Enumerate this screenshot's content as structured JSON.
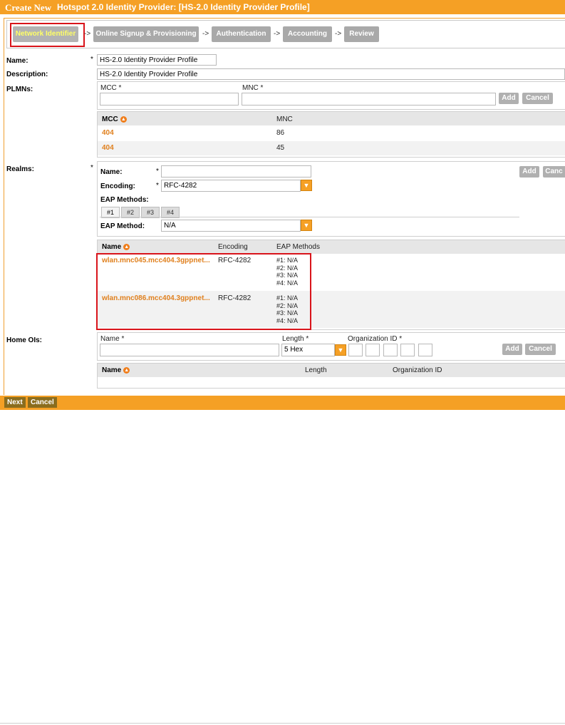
{
  "title": {
    "prefix": "Create New",
    "text": "Hotspot 2.0 Identity Provider: [HS-2.0 Identity Provider Profile]"
  },
  "wizard": {
    "steps": [
      "Network Identifier",
      "Online Signup & Provisioning",
      "Authentication",
      "Accounting",
      "Review"
    ],
    "arrow": "->"
  },
  "form": {
    "name_label": "Name:",
    "name_value": "HS-2.0 Identity Provider Profile",
    "description_label": "Description:",
    "description_value": "HS-2.0 Identity Provider Profile",
    "required_mark": "*"
  },
  "plmns": {
    "label": "PLMNs:",
    "mcc_label": "MCC *",
    "mnc_label": "MNC *",
    "add": "Add",
    "cancel": "Cancel",
    "columns": [
      "MCC",
      "MNC"
    ],
    "rows": [
      [
        "404",
        "86"
      ],
      [
        "404",
        "45"
      ]
    ]
  },
  "realms": {
    "label": "Realms:",
    "name_label": "Name:",
    "encoding_label": "Encoding:",
    "encoding_value": "RFC-4282",
    "eap_methods_label": "EAP Methods:",
    "tabs": [
      "#1",
      "#2",
      "#3",
      "#4"
    ],
    "eap_method_label": "EAP Method:",
    "eap_method_value": "N/A",
    "add": "Add",
    "cancel": "Canc",
    "columns": [
      "Name",
      "Encoding",
      "EAP Methods"
    ],
    "rows": [
      {
        "name": "wlan.mnc045.mcc404.3gppnet...",
        "encoding": "RFC-4282",
        "eap": [
          "#1: N/A",
          "#2: N/A",
          "#3: N/A",
          "#4: N/A"
        ]
      },
      {
        "name": "wlan.mnc086.mcc404.3gppnet...",
        "encoding": "RFC-4282",
        "eap": [
          "#1: N/A",
          "#2: N/A",
          "#3: N/A",
          "#4: N/A"
        ]
      }
    ]
  },
  "home_ois": {
    "label": "Home OIs:",
    "name_label": "Name *",
    "length_label": "Length *",
    "length_value": "5 Hex",
    "org_id_label": "Organization ID *",
    "add": "Add",
    "cancel": "Cancel",
    "columns": [
      "Name",
      "Length",
      "Organization ID"
    ]
  },
  "footer": {
    "next": "Next",
    "cancel": "Cancel"
  },
  "colors": {
    "accent": "#f5a025",
    "link": "#e0801e",
    "highlight_box": "#d9141b"
  }
}
